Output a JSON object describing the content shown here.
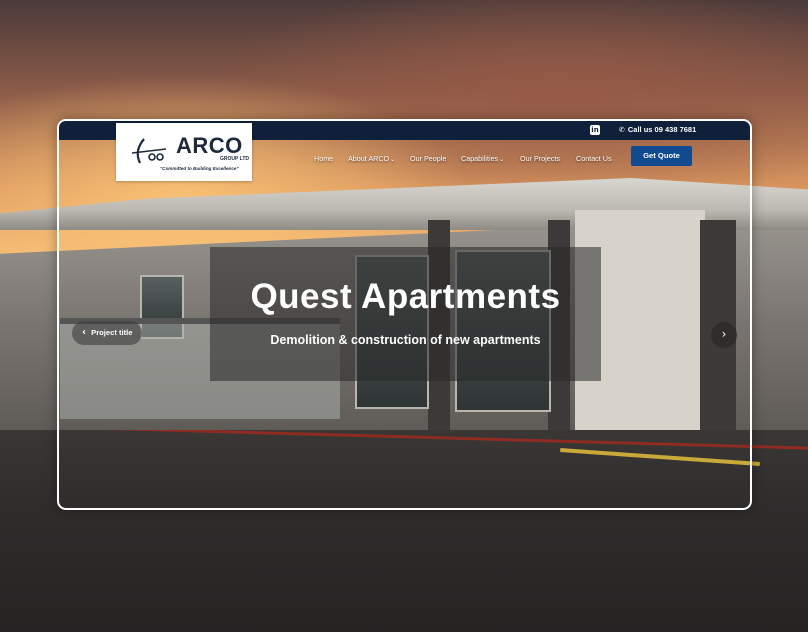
{
  "topbar": {
    "linkedin_icon": "linkedin-icon",
    "call_text": "Call us  09 438 7681",
    "phone_icon": "phone-icon"
  },
  "logo": {
    "name": "ARCO",
    "sub": "GROUP LTD",
    "tagline": "\"Committed to Building Excellence\""
  },
  "nav": {
    "items": [
      {
        "label": "Home",
        "dropdown": false
      },
      {
        "label": "About ARCO",
        "dropdown": true
      },
      {
        "label": "Our People",
        "dropdown": false
      },
      {
        "label": "Capabilities",
        "dropdown": true
      },
      {
        "label": "Our Projects",
        "dropdown": false
      },
      {
        "label": "Contact Us",
        "dropdown": false
      }
    ],
    "chevron": "⌄",
    "quote_label": "Get Quote"
  },
  "hero": {
    "title": "Quest Apartments",
    "subtitle": "Demolition & construction of new apartments",
    "prev_label": "Project title",
    "prev_arrow": "‹",
    "next_arrow": "›"
  },
  "colors": {
    "topbar": "#10203a",
    "accent": "#114a8f",
    "frame_border": "#ffffff"
  }
}
